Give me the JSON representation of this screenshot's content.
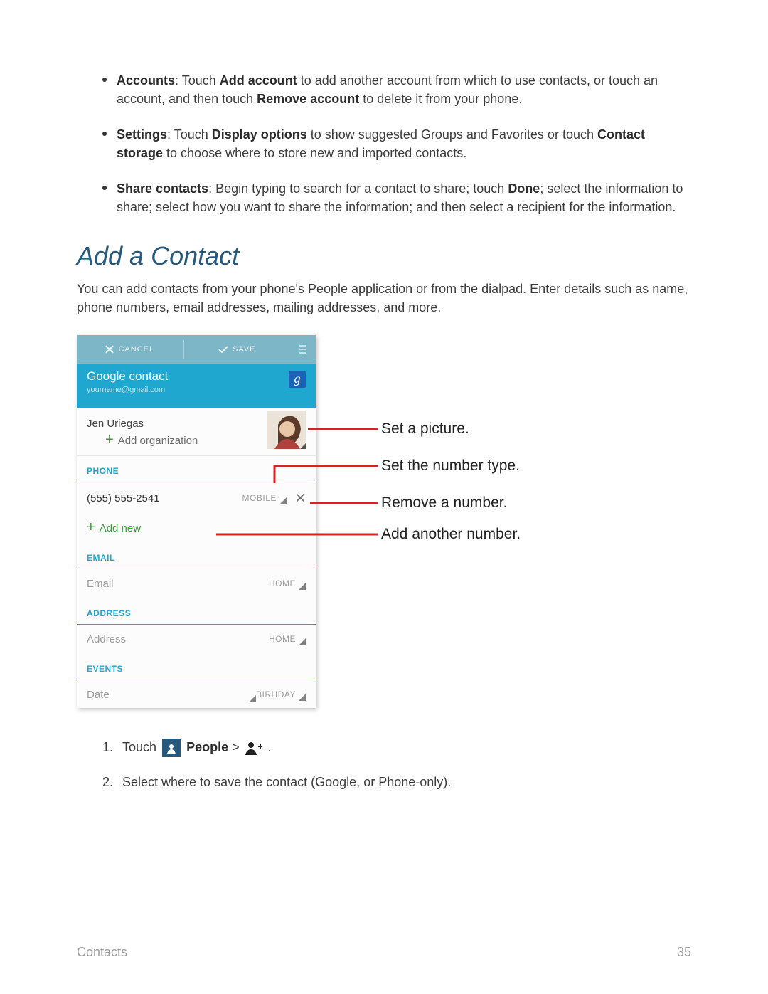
{
  "bullets": {
    "accounts": {
      "label": "Accounts",
      "text1": ": Touch ",
      "bold1": "Add account",
      "text2": " to add another account from which to use contacts, or touch an account, and then touch ",
      "bold2": "Remove account",
      "text3": " to delete it from your phone."
    },
    "settings": {
      "label": "Settings",
      "text1": ": Touch ",
      "bold1": "Display options",
      "text2": " to show suggested Groups and Favorites or touch ",
      "bold2": "Contact storage",
      "text3": " to choose where to store new and imported contacts."
    },
    "share": {
      "label": "Share contacts",
      "text1": ": Begin typing to search for a contact to share; touch ",
      "bold1": "Done",
      "text2": "; select the information to share; select how you want to share the information; and then select a recipient for the information."
    }
  },
  "heading": "Add a Contact",
  "intro": "You can add contacts from your phone's People application or from the dialpad. Enter details such as name, phone numbers, email addresses, mailing addresses, and more.",
  "phone": {
    "cancel": "CANCEL",
    "save": "SAVE",
    "account_title": "Google contact",
    "account_sub": "yourname@gmail.com",
    "g_badge": "g",
    "name": "Jen Uriegas",
    "add_org": "Add organization",
    "section_phone": "PHONE",
    "phone_number": "(555) 555-2541",
    "phone_type": "MOBILE",
    "add_new": "Add new",
    "section_email": "EMAIL",
    "email_placeholder": "Email",
    "email_type": "HOME",
    "section_address": "ADDRESS",
    "address_placeholder": "Address",
    "address_type": "HOME",
    "section_events": "EVENTS",
    "date_placeholder": "Date",
    "event_type": "BIRHDAY"
  },
  "annotations": {
    "a1": "Set a picture.",
    "a2": "Set the number type.",
    "a3": "Remove a number.",
    "a4": "Add another number."
  },
  "steps": {
    "s1a": "Touch ",
    "s1_people": "People",
    "s1b": " > ",
    "s1c": ".",
    "s2": "Select where to save the contact (Google, or Phone-only)."
  },
  "footer": {
    "section": "Contacts",
    "page": "35"
  }
}
